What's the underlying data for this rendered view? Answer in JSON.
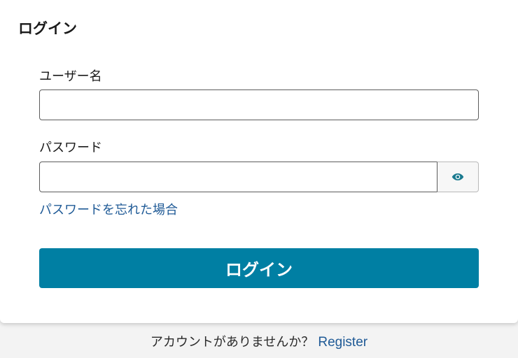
{
  "card": {
    "title": "ログイン"
  },
  "form": {
    "username_label": "ユーザー名",
    "username_value": "",
    "password_label": "パスワード",
    "password_value": "",
    "show_password_icon": "eye-icon",
    "forgot_password_link": "パスワードを忘れた場合",
    "login_button_label": "ログイン"
  },
  "footer": {
    "no_account_text": "アカウントがありませんか？",
    "register_link": "Register"
  },
  "colors": {
    "primary_button": "#007fa3",
    "link": "#1f5a96",
    "eye_icon": "#1a7a8f"
  }
}
